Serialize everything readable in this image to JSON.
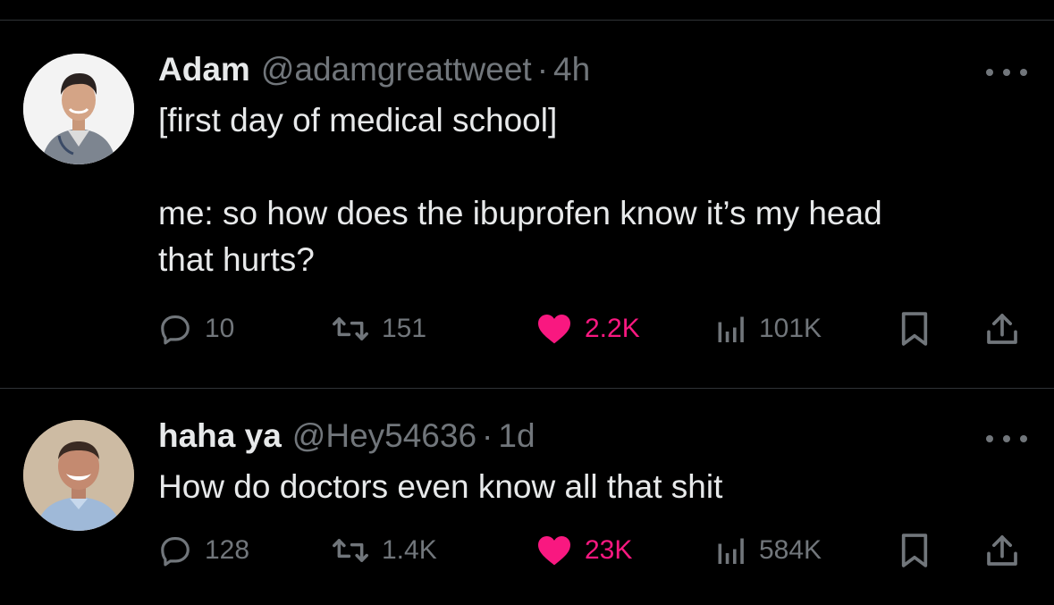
{
  "tweets": [
    {
      "name": "Adam",
      "handle": "@adamgreattweet",
      "separator": "·",
      "time": "4h",
      "lines": [
        "[first day of medical school]",
        "",
        "me: so how does the ibuprofen know it’s my head",
        "that hurts?"
      ],
      "stats": {
        "replies": "10",
        "retweets": "151",
        "likes": "2.2K",
        "views": "101K"
      }
    },
    {
      "name": "haha ya",
      "handle": "@Hey54636",
      "separator": "·",
      "time": "1d",
      "lines": [
        "How do doctors even know all that shit"
      ],
      "stats": {
        "replies": "128",
        "retweets": "1.4K",
        "likes": "23K",
        "views": "584K"
      }
    }
  ],
  "icons": {
    "reply": "reply-icon",
    "retweet": "retweet-icon",
    "like": "heart-icon",
    "views": "views-icon",
    "bookmark": "bookmark-icon",
    "share": "share-icon",
    "more": "more-icon"
  },
  "colors": {
    "background": "#000000",
    "primary_text": "#e7e9ea",
    "secondary_text": "#71767b",
    "like": "#f91880",
    "divider": "#2f3336"
  }
}
